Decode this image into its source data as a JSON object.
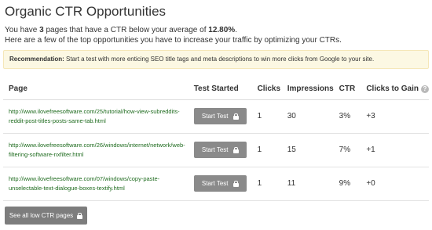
{
  "header": {
    "title": "Organic CTR Opportunities"
  },
  "summary": {
    "line1_prefix": "You have ",
    "page_count": "3",
    "line1_middle": " pages that have a CTR below your average of ",
    "average_ctr": "12.80%",
    "line1_suffix": ".",
    "line2": "Here are a few of the top opportunities you have to increase your traffic by optimizing your CTRs."
  },
  "recommendation": {
    "label": "Recommendation:",
    "text": " Start a test with more enticing SEO title tags and meta descriptions to win more clicks from Google to your site."
  },
  "table": {
    "headers": {
      "page": "Page",
      "test_started": "Test Started",
      "clicks": "Clicks",
      "impressions": "Impressions",
      "ctr": "CTR",
      "clicks_to_gain": "Clicks to Gain"
    },
    "help_icon": "question-circle-icon",
    "rows": [
      {
        "url": "http://www.ilovefreesoftware.com/25/tutorial/how-view-subreddits-reddit-post-titles-posts-same-tab.html",
        "button": "Start Test",
        "clicks": "1",
        "impressions": "30",
        "ctr": "3%",
        "clicks_to_gain": "+3"
      },
      {
        "url": "http://www.ilovefreesoftware.com/26/windows/internet/network/web-filtering-software-nxfilter.html",
        "button": "Start Test",
        "clicks": "1",
        "impressions": "15",
        "ctr": "7%",
        "clicks_to_gain": "+1"
      },
      {
        "url": "http://www.ilovefreesoftware.com/07/windows/copy-paste-unselectable-text-dialogue-boxes-textify.html",
        "button": "Start Test",
        "clicks": "1",
        "impressions": "11",
        "ctr": "9%",
        "clicks_to_gain": "+0"
      }
    ]
  },
  "footer": {
    "see_all": "See all low CTR pages"
  },
  "colors": {
    "url_text": "#1e6b1e",
    "button_bg": "#8a8a8a",
    "recommendation_bg": "#fcf8e3"
  }
}
